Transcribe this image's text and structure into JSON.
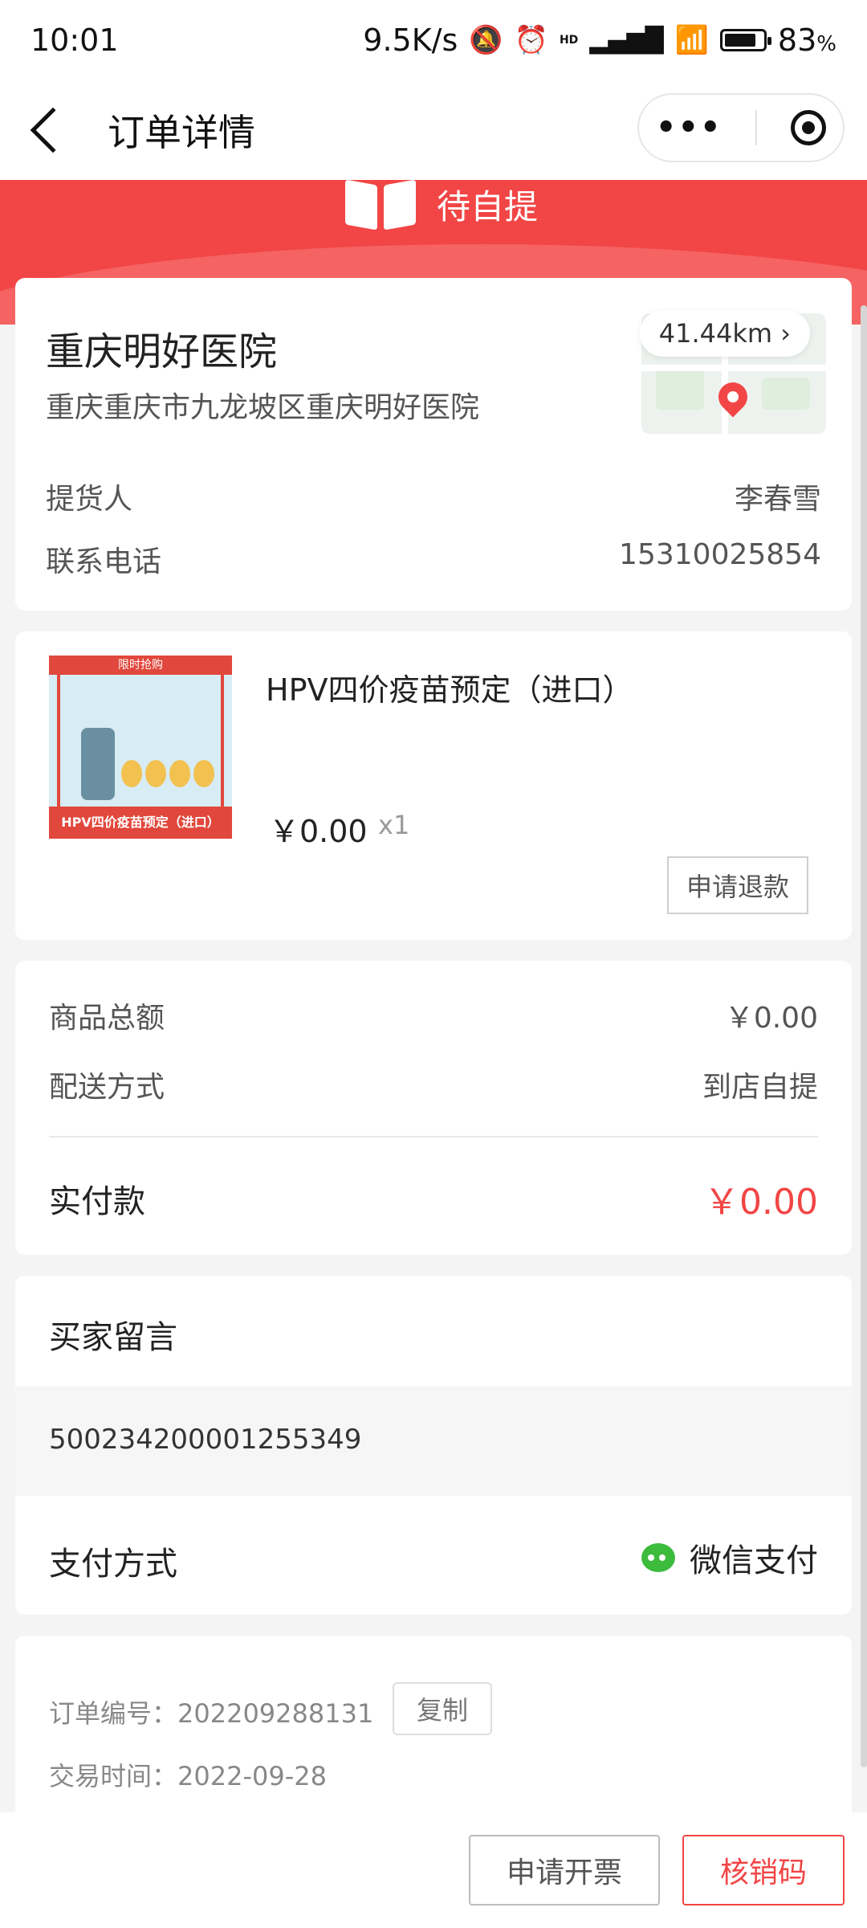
{
  "status_bar": {
    "time": "10:01",
    "network_speed": "9.5K/s",
    "battery": "83",
    "battery_unit": "%",
    "battery_level": 0.83,
    "hd_label": "HD"
  },
  "navbar": {
    "title": "订单详情"
  },
  "banner": {
    "status": "待自提",
    "color": "#f24545"
  },
  "pickup": {
    "hospital_name": "重庆明好医院",
    "address": "重庆重庆市九龙坡区重庆明好医院",
    "distance": "41.44km",
    "pickup_person_label": "提货人",
    "pickup_person": "李春雪",
    "phone_label": "联系电话",
    "phone": "15310025854"
  },
  "product": {
    "name": "HPV四价疫苗预定（进口）",
    "price": "￥0.00",
    "quantity": "x1",
    "refund_label": "申请退款",
    "thumb_top_text": "限时抢购",
    "thumb_bottom_text": "HPV四价疫苗预定（进口）"
  },
  "summary": {
    "goods_total_label": "商品总额",
    "goods_total": "￥0.00",
    "delivery_label": "配送方式",
    "delivery": "到店自提",
    "paid_label": "实付款",
    "paid": "￥0.00"
  },
  "message": {
    "title": "买家留言",
    "content": "500234200001255349",
    "payment_label": "支付方式",
    "payment_method": "微信支付"
  },
  "order_info": {
    "order_no": "订单编号：202209288131",
    "copy_label": "复制",
    "trade_time": "交易时间：2022-09-28"
  },
  "bottom_bar": {
    "invoice_label": "申请开票",
    "verify_label": "核销码"
  }
}
